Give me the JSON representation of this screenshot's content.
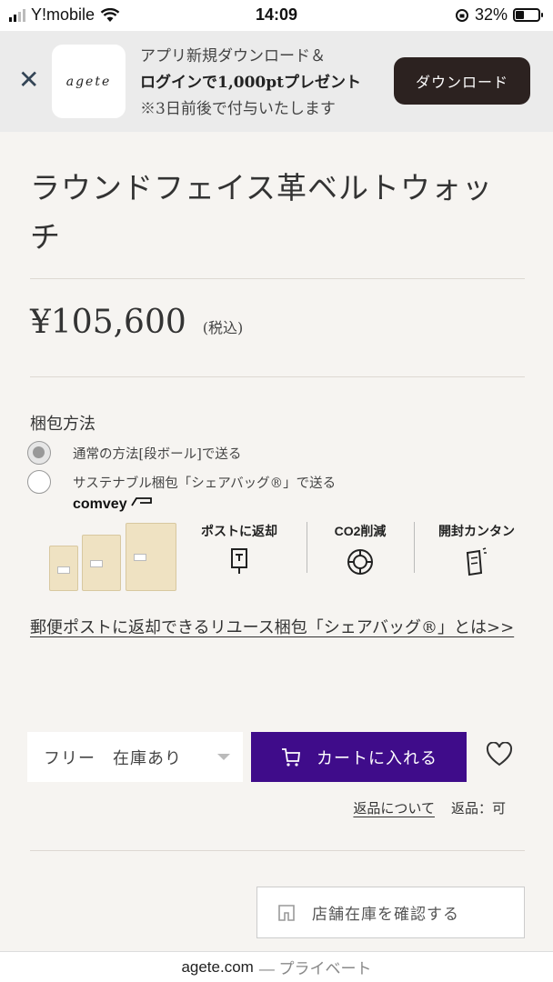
{
  "status_bar": {
    "carrier": "Y!mobile",
    "time": "14:09",
    "battery": "32%"
  },
  "app_banner": {
    "logo_text": "agete",
    "line1": "アプリ新規ダウンロード＆",
    "line2": "ログインで1,000ptプレゼント",
    "line3": "※3日前後で付与いたします",
    "download_label": "ダウンロード"
  },
  "product": {
    "title": "ラウンドフェイス革ベルトウォッチ",
    "price": "¥105,600",
    "tax_note": "(税込)"
  },
  "packaging": {
    "label": "梱包方法",
    "options": [
      {
        "label": "通常の方法[段ボール]で送る",
        "selected": true
      },
      {
        "label": "サステナブル梱包「シェアバッグ®」で送る",
        "selected": false
      }
    ],
    "brand": "comvey",
    "features": [
      "ポストに返却",
      "CO2削減",
      "開封カンタン"
    ],
    "info_link": "郵便ポストに返却できるリユース梱包「シェアバッグ®」とは>>"
  },
  "purchase": {
    "size_stock": "フリー　在庫あり",
    "cart_label": "カートに入れる",
    "returns_link": "返品について",
    "returns_status": "返品：可",
    "store_stock_label": "店舗在庫を確認する"
  },
  "url_bar": {
    "domain": "agete.com",
    "mode": "— プライベート"
  },
  "colors": {
    "cart_button": "#3f0c8a",
    "download_button": "#2c2220",
    "background": "#f6f4f1"
  }
}
